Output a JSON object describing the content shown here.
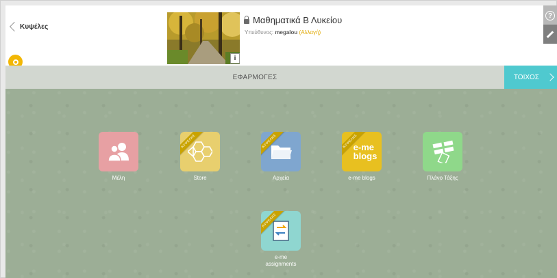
{
  "header": {
    "back_label": "Κυψέλες",
    "course_title": "Μαθηματικά Β Λυκείου",
    "owner_prefix": "Υπεύθυνος:",
    "owner_name": "megalou",
    "owner_change": "(Αλλαγή)",
    "info_label": "i",
    "help_label": "?"
  },
  "tabs": {
    "apps_label": "ΕΦΑΡΜΟΓΕΣ",
    "wall_label": "ΤΟΙΧΟΣ"
  },
  "apps": [
    {
      "label": "Μέλη",
      "color": "#e7a0a3",
      "icon": "users-icon",
      "ribbon": ""
    },
    {
      "label": "Store",
      "color": "#e8cf6e",
      "icon": "hexagons-icon",
      "ribbon": "ΚΥΨΕΛΗΣ"
    },
    {
      "label": "Αρχεία",
      "color": "#7fa6cf",
      "icon": "folder-icon",
      "ribbon": "ΚΥΨΕΛΗΣ"
    },
    {
      "label": "e-me blogs",
      "color": "#e8c020",
      "icon": "blogs-icon",
      "icon_text": "e-me\nblogs",
      "ribbon": "ΚΥΨΕΛΗΣ"
    },
    {
      "label": "Πλάνο Τάξης",
      "color": "#8fd88a",
      "icon": "class-plan-icon",
      "ribbon": ""
    },
    {
      "label": "e-me assignments",
      "color": "#8fd6d0",
      "icon": "assignments-icon",
      "ribbon": "ΚΥΨΕΛΗΣ"
    }
  ],
  "blogs_icon": {
    "line1": "e-me",
    "line2": "blogs"
  }
}
